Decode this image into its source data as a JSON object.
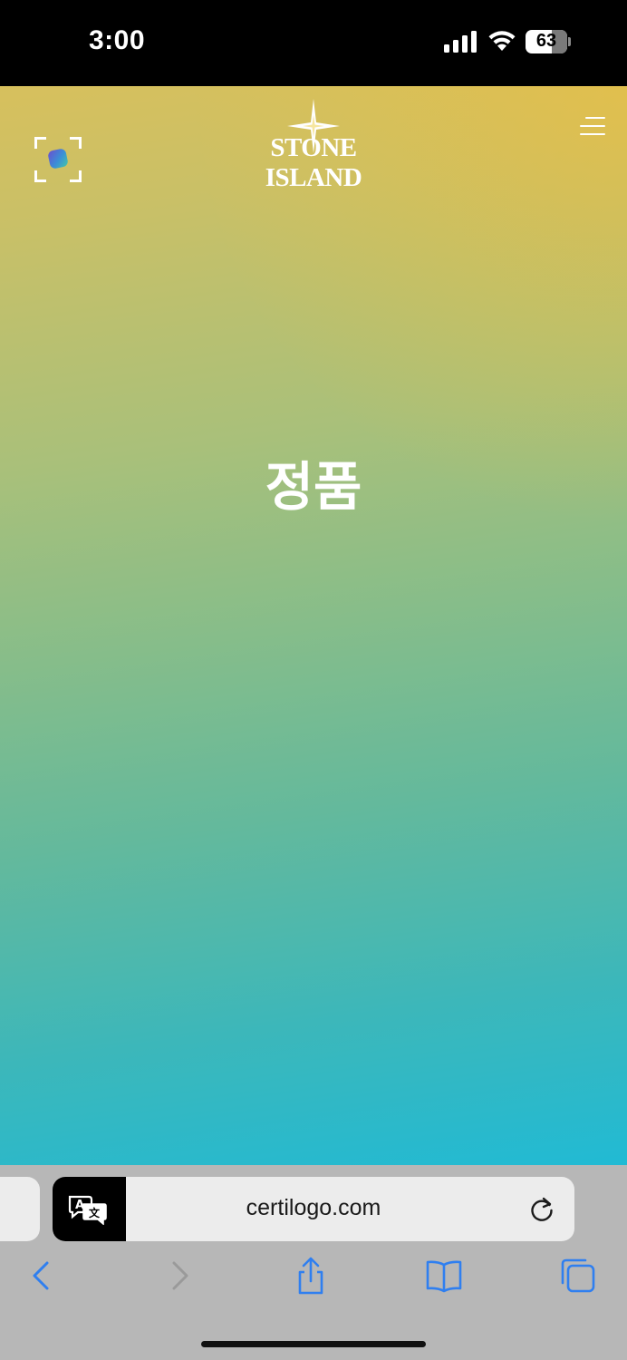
{
  "status_bar": {
    "time": "3:00",
    "battery_percent": "63",
    "icons": [
      "cellular-signal-icon",
      "wifi-icon",
      "battery-icon"
    ]
  },
  "page": {
    "brand": "STONE ISLAND",
    "headline": "정품",
    "background_colors": [
      "#d7c05d",
      "#86bd8a",
      "#21bad4"
    ],
    "icons": [
      "scan-icon",
      "hamburger-menu-icon"
    ]
  },
  "browser": {
    "url": "certilogo.com",
    "icons": [
      "translate-icon",
      "reload-icon",
      "back-icon",
      "forward-icon",
      "share-icon",
      "bookmarks-icon",
      "tabs-icon"
    ],
    "accent_color": "#2f7ff0"
  }
}
